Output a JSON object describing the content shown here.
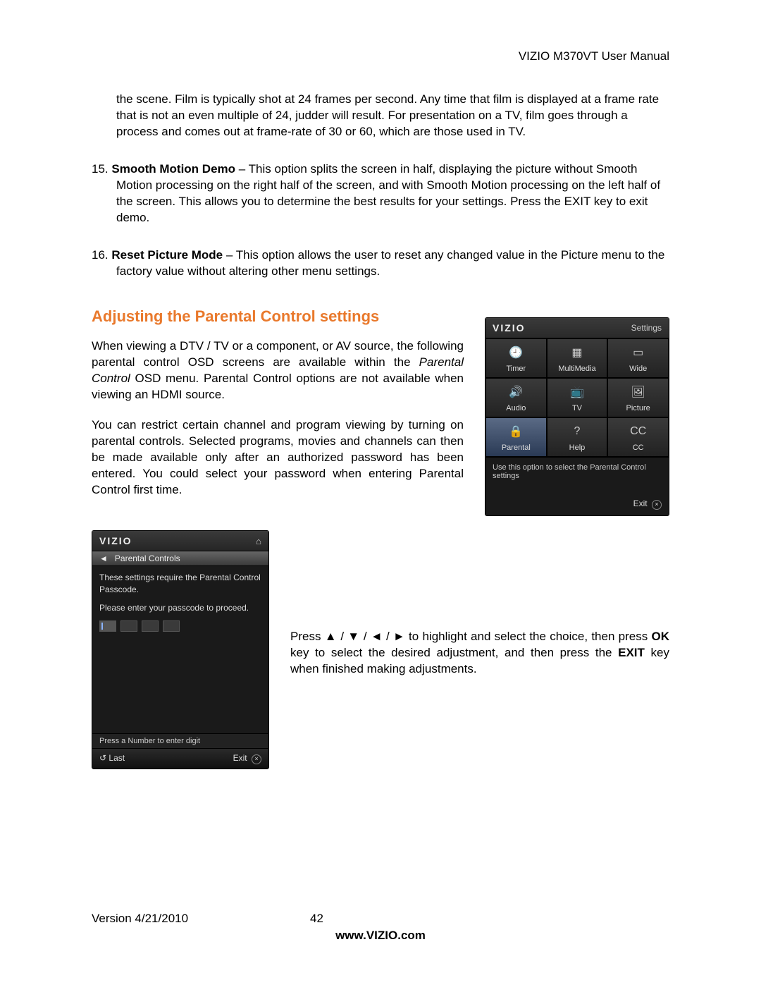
{
  "header": {
    "title": "VIZIO M370VT User Manual"
  },
  "intro_continuation": "the scene. Film is typically shot at 24 frames per second. Any time that film is displayed at a frame rate that is not an even multiple of 24, judder will result. For presentation on a TV, film goes through a process and comes out at frame-rate of 30 or 60, which are those used in TV.",
  "items": [
    {
      "num": "15.",
      "title": "Smooth Motion Demo",
      "dash": " – ",
      "lead": "This",
      "text": " option splits the screen in half, displaying the picture without Smooth Motion processing on the right half of the screen, and with Smooth Motion processing on the left half of the screen. This allows you to determine the best results for your settings. Press the EXIT key to exit demo."
    },
    {
      "num": "16.",
      "title": "Reset Picture Mode",
      "dash": " – ",
      "lead": "",
      "text": "This option allows the user to reset any changed value in the Picture menu to the factory value without altering other menu settings."
    }
  ],
  "section_heading": "Adjusting the Parental Control settings",
  "para1_a": "When viewing a DTV / TV or a component, or AV source, the following parental control OSD screens are available within the ",
  "para1_italic": "Parental Control",
  "para1_b": " OSD menu. Parental Control options are not available when viewing an HDMI source.",
  "para2": "You can restrict certain channel and program viewing by turning on parental controls. Selected programs, movies and channels can then be made available only after an authorized password has been entered. You could select your password when entering Parental Control first time.",
  "settings_osd": {
    "brand": "VIZIO",
    "label": "Settings",
    "cells": [
      {
        "icon": "🕘",
        "label": "Timer"
      },
      {
        "icon": "▦",
        "label": "MultiMedia"
      },
      {
        "icon": "▭",
        "label": "Wide"
      },
      {
        "icon": "🔊",
        "label": "Audio"
      },
      {
        "icon": "📺",
        "label": "TV"
      },
      {
        "icon": "🖼",
        "label": "Picture"
      },
      {
        "icon": "🔒",
        "label": "Parental",
        "selected": true
      },
      {
        "icon": "?",
        "label": "Help"
      },
      {
        "icon": "CC",
        "label": "CC"
      }
    ],
    "hint": "Use this option to select the Parental Control settings",
    "exit": "Exit"
  },
  "passcode_osd": {
    "brand": "VIZIO",
    "bar_arrow": "◄",
    "bar_title": "Parental Controls",
    "line1": "These settings require the Parental Control Passcode.",
    "line2": "Please enter your passcode to proceed.",
    "hint": "Press a Number to enter digit",
    "last": "Last",
    "exit": "Exit"
  },
  "instruction": {
    "a": "Press ",
    "arrows": "▲ / ▼ / ◄ / ►",
    "b": " to highlight and select the choice, then press ",
    "ok": "OK",
    "c": " key to select the desired adjustment, and then press the ",
    "exit": "EXIT",
    "d": " key when finished making adjustments."
  },
  "footer": {
    "version": "Version 4/21/2010",
    "page": "42",
    "url": "www.VIZIO.com"
  }
}
